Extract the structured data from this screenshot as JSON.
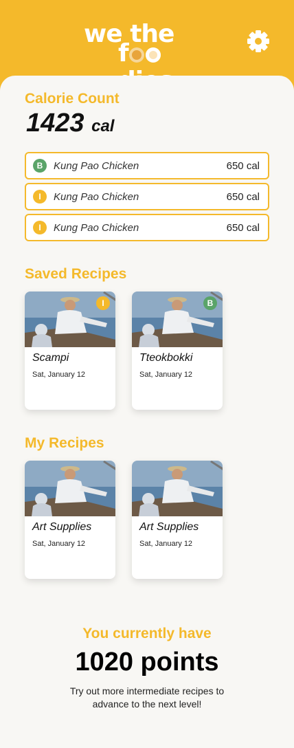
{
  "brand": {
    "line1": "we the",
    "line2_prefix": "f",
    "line2_suffix": "dies",
    "color": "#f4b92b"
  },
  "header": {
    "settings_icon": "gear-icon"
  },
  "calorie": {
    "title": "Calorie Count",
    "value": "1423",
    "unit": "cal",
    "meals": [
      {
        "badge": "B",
        "badge_color": "#5aa469",
        "name": "Kung Pao Chicken",
        "calories": "650 cal"
      },
      {
        "badge": "I",
        "badge_color": "#f4b92b",
        "name": "Kung Pao Chicken",
        "calories": "650 cal"
      },
      {
        "badge": "I",
        "badge_color": "#f4b92b",
        "name": "Kung Pao Chicken",
        "calories": "650 cal"
      }
    ]
  },
  "saved": {
    "title": "Saved Recipes",
    "cards": [
      {
        "title": "Scampi",
        "date": "Sat, January 12",
        "badge": "I",
        "badge_color": "#f4b92b"
      },
      {
        "title": "Tteokbokki",
        "date": "Sat, January 12",
        "badge": "B",
        "badge_color": "#5aa469"
      }
    ]
  },
  "mine": {
    "title": "My Recipes",
    "cards": [
      {
        "title": "Art Supplies",
        "date": "Sat, January 12"
      },
      {
        "title": "Art Supplies",
        "date": "Sat, January 12"
      }
    ]
  },
  "points": {
    "heading": "You currently have",
    "value": "1020 points",
    "hint": "Try out more intermediate recipes to advance to the next level!"
  }
}
